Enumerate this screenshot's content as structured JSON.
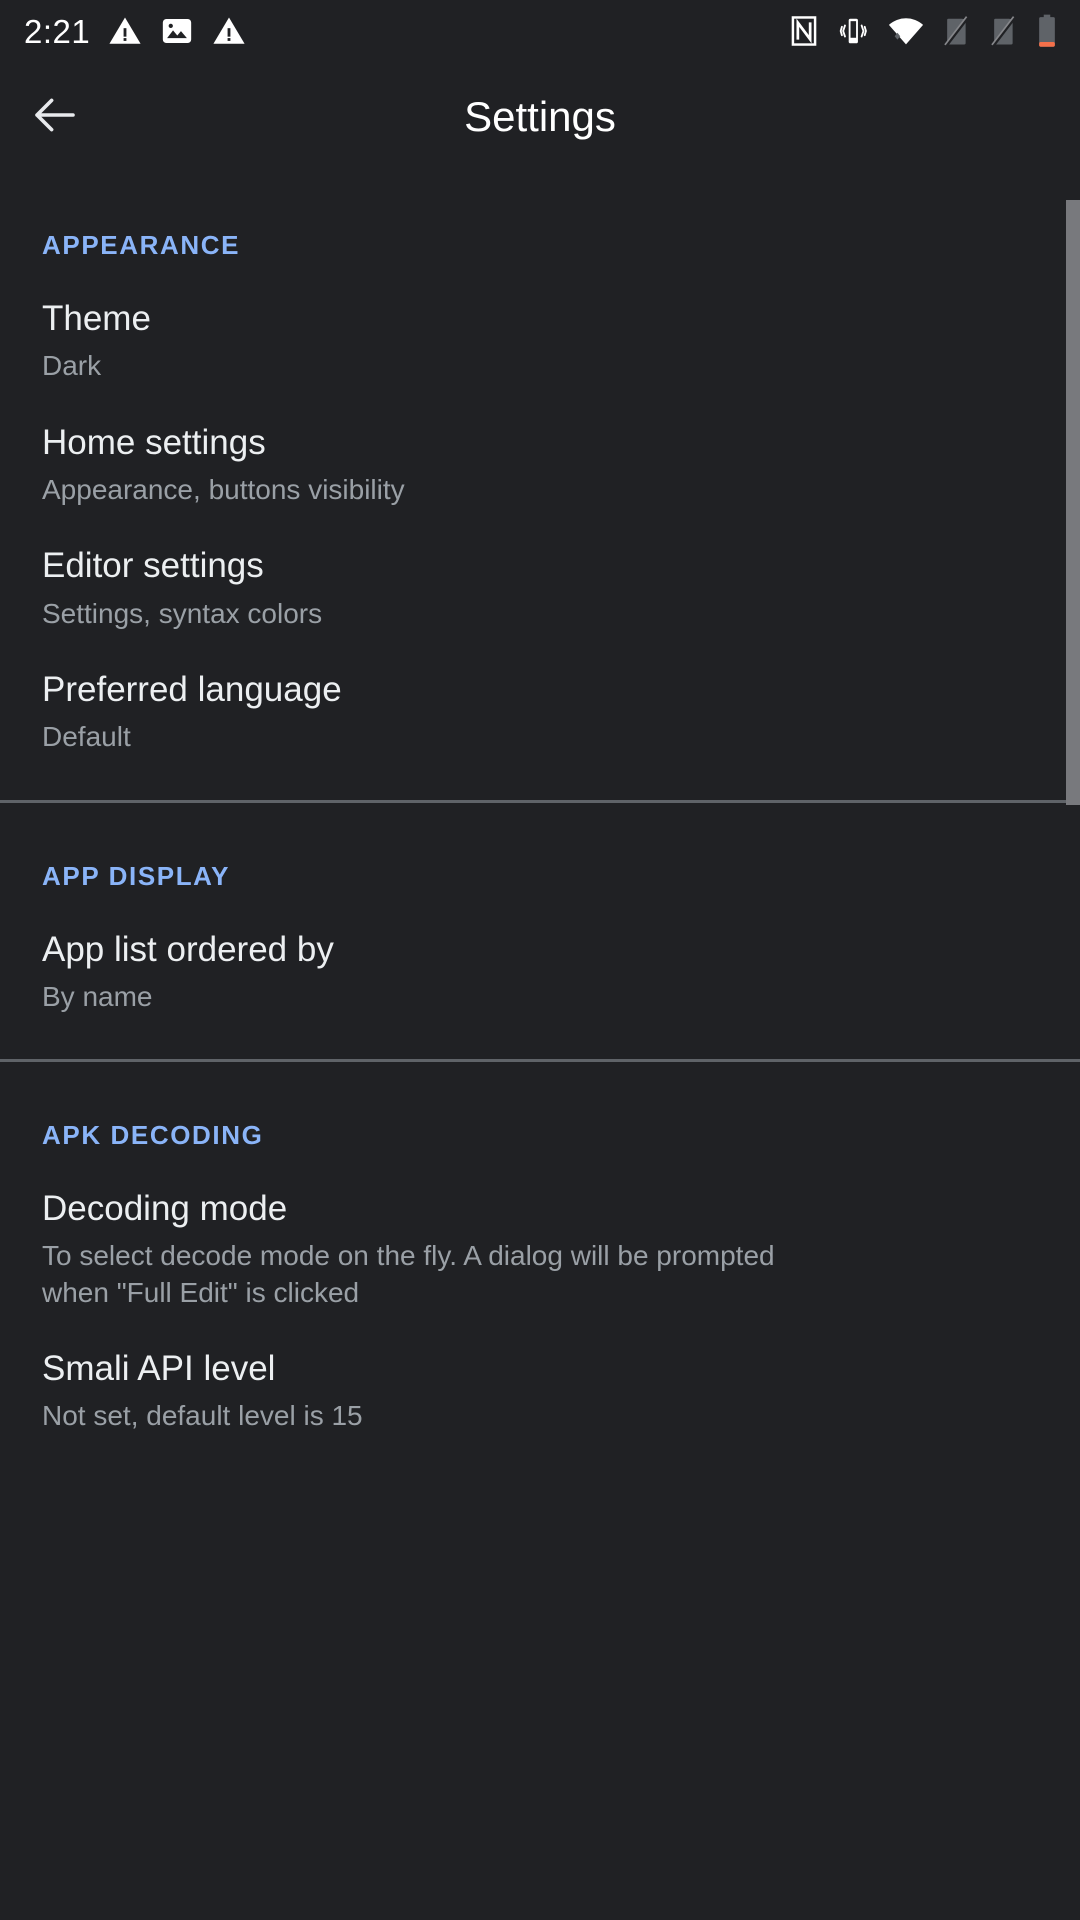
{
  "status_bar": {
    "clock": "2:21",
    "left_icons": [
      "warning-triangle-icon",
      "image-icon",
      "warning-triangle-icon"
    ],
    "right_icons": [
      "nfc-icon",
      "vibrate-icon",
      "wifi-icon",
      "mobile-signal-off-icon",
      "mobile-signal-off-icon",
      "battery-low-icon"
    ],
    "colors": {
      "foreground": "#ffffff",
      "disabled": "#5f6368",
      "battery_level": "#f4704a"
    }
  },
  "app_bar": {
    "title": "Settings",
    "back_icon": "arrow-left-icon"
  },
  "theme": {
    "background": "#202124",
    "accent": "#8ab4f8",
    "title_text": "#eceff1",
    "summary_text": "#9aa0a6",
    "divider": "#5f6368",
    "scrollbar": "#78797d"
  },
  "sections": [
    {
      "header": "APPEARANCE",
      "items": [
        {
          "title": "Theme",
          "summary": "Dark"
        },
        {
          "title": "Home settings",
          "summary": "Appearance, buttons visibility"
        },
        {
          "title": "Editor settings",
          "summary": "Settings, syntax colors"
        },
        {
          "title": "Preferred language",
          "summary": "Default"
        }
      ]
    },
    {
      "header": "APP DISPLAY",
      "items": [
        {
          "title": "App list ordered by",
          "summary": "By name"
        }
      ]
    },
    {
      "header": "APK DECODING",
      "items": [
        {
          "title": "Decoding mode",
          "summary": "To select decode mode on the fly. A dialog will be prompted when \"Full Edit\" is clicked"
        },
        {
          "title": "Smali API level",
          "summary": "Not set, default level is 15"
        }
      ]
    }
  ]
}
